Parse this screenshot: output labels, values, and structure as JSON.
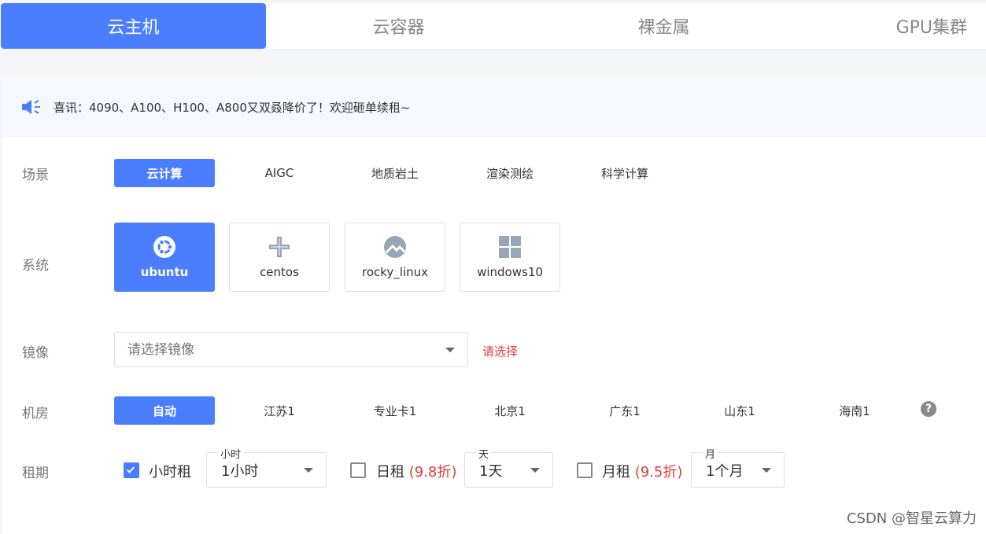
{
  "tabs": [
    {
      "label": "云主机",
      "active": true
    },
    {
      "label": "云容器",
      "active": false
    },
    {
      "label": "裸金属",
      "active": false
    },
    {
      "label": "GPU集群",
      "active": false
    }
  ],
  "notice": {
    "icon": "megaphone-icon",
    "text": "喜讯：4090、A100、H100、A800又双叒降价了！欢迎砸单续租~"
  },
  "scene": {
    "label": "场景",
    "options": [
      "云计算",
      "AIGC",
      "地质岩土",
      "渲染测绘",
      "科学计算"
    ],
    "selected": "云计算"
  },
  "system": {
    "label": "系统",
    "options": [
      {
        "name": "ubuntu",
        "icon": "ubuntu-icon"
      },
      {
        "name": "centos",
        "icon": "centos-icon"
      },
      {
        "name": "rocky_linux",
        "icon": "rocky-linux-icon"
      },
      {
        "name": "windows10",
        "icon": "windows-icon"
      }
    ],
    "selected": "ubuntu"
  },
  "image": {
    "label": "镜像",
    "placeholder": "请选择镜像",
    "hint": "请选择"
  },
  "room": {
    "label": "机房",
    "options": [
      "自动",
      "江苏1",
      "专业卡1",
      "北京1",
      "广东1",
      "山东1",
      "海南1"
    ],
    "selected": "自动",
    "help_icon": "?"
  },
  "rent": {
    "label": "租期",
    "hourly": {
      "label": "小时租",
      "checked": true,
      "select_title": "小时",
      "value": "1小时"
    },
    "daily": {
      "label": "日租",
      "discount": "(9.8折)",
      "checked": false,
      "select_title": "天",
      "value": "1天"
    },
    "monthly": {
      "label": "月租",
      "discount": "(9.5折)",
      "checked": false,
      "select_title": "月",
      "value": "1个月"
    }
  },
  "watermark": "CSDN @智星云算力",
  "colors": {
    "accent": "#4a7dff",
    "warning": "#e03b3b"
  }
}
